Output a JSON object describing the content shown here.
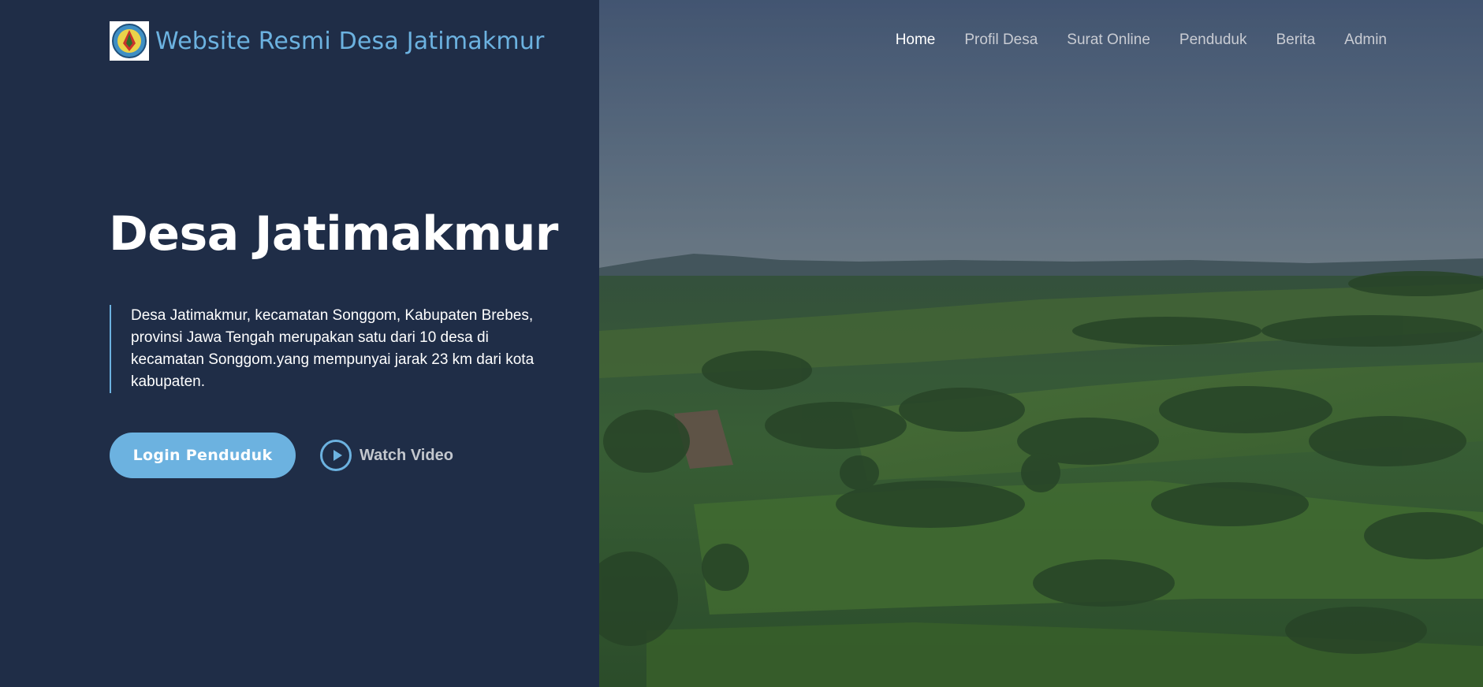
{
  "header": {
    "brand_title": "Website Resmi Desa Jatimakmur",
    "logo_icon": "village-emblem-icon",
    "nav": [
      {
        "label": "Home",
        "active": true
      },
      {
        "label": "Profil Desa",
        "active": false
      },
      {
        "label": "Surat Online",
        "active": false
      },
      {
        "label": "Penduduk",
        "active": false
      },
      {
        "label": "Berita",
        "active": false
      },
      {
        "label": "Admin",
        "active": false
      }
    ]
  },
  "hero": {
    "title": "Desa Jatimakmur",
    "description": "Desa Jatimakmur, kecamatan Songgom, Kabupaten Brebes, provinsi Jawa Tengah merupakan satu dari 10 desa di kecamatan Songgom.yang mempunyai jarak 23 km dari kota kabupaten.",
    "login_button": "Login Penduduk",
    "watch_video": "Watch Video",
    "play_icon": "play-circle-icon"
  },
  "colors": {
    "panel_background": "#1f2d47",
    "accent": "#6cb2e0",
    "nav_text": "#c9ccd3",
    "nav_active": "#ffffff"
  }
}
